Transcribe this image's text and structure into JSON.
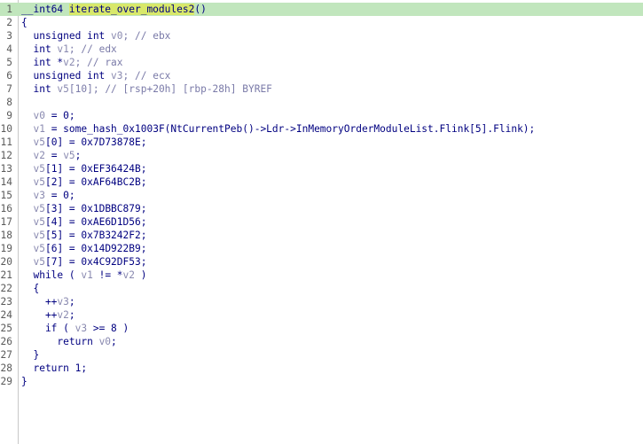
{
  "editor": {
    "lines": [
      {
        "n": "1",
        "parts": [
          {
            "t": "__int64 ",
            "c": "kw"
          },
          {
            "t": "iterate_over_modules2",
            "c": "fn-hl"
          },
          {
            "t": "()",
            "c": "plain"
          }
        ],
        "current": true
      },
      {
        "n": "2",
        "parts": [
          {
            "t": "{",
            "c": "plain"
          }
        ]
      },
      {
        "n": "3",
        "parts": [
          {
            "t": "  unsigned int ",
            "c": "kw"
          },
          {
            "t": "v0",
            "c": "var"
          },
          {
            "t": "; // ebx",
            "c": "cmt"
          }
        ]
      },
      {
        "n": "4",
        "parts": [
          {
            "t": "  int ",
            "c": "kw"
          },
          {
            "t": "v1",
            "c": "var"
          },
          {
            "t": "; // edx",
            "c": "cmt"
          }
        ]
      },
      {
        "n": "5",
        "parts": [
          {
            "t": "  int *",
            "c": "kw"
          },
          {
            "t": "v2",
            "c": "var"
          },
          {
            "t": "; // rax",
            "c": "cmt"
          }
        ]
      },
      {
        "n": "6",
        "parts": [
          {
            "t": "  unsigned int ",
            "c": "kw"
          },
          {
            "t": "v3",
            "c": "var"
          },
          {
            "t": "; // ecx",
            "c": "cmt"
          }
        ]
      },
      {
        "n": "7",
        "parts": [
          {
            "t": "  int ",
            "c": "kw"
          },
          {
            "t": "v5",
            "c": "var"
          },
          {
            "t": "[10]; // [rsp+20h] [rbp-28h] BYREF",
            "c": "cmt"
          }
        ]
      },
      {
        "n": "8",
        "parts": []
      },
      {
        "n": "9",
        "parts": [
          {
            "t": "  ",
            "c": "plain"
          },
          {
            "t": "v0",
            "c": "var"
          },
          {
            "t": " = 0;",
            "c": "plain"
          }
        ]
      },
      {
        "n": "10",
        "parts": [
          {
            "t": "  ",
            "c": "plain"
          },
          {
            "t": "v1",
            "c": "var"
          },
          {
            "t": " = some_hash_0x1003F(NtCurrentPeb()->Ldr->InMemoryOrderModuleList.Flink[5].Flink);",
            "c": "plain"
          }
        ]
      },
      {
        "n": "11",
        "parts": [
          {
            "t": "  ",
            "c": "plain"
          },
          {
            "t": "v5",
            "c": "var"
          },
          {
            "t": "[0] = 0x7D73878E;",
            "c": "plain"
          }
        ]
      },
      {
        "n": "12",
        "parts": [
          {
            "t": "  ",
            "c": "plain"
          },
          {
            "t": "v2",
            "c": "var"
          },
          {
            "t": " = ",
            "c": "plain"
          },
          {
            "t": "v5",
            "c": "var"
          },
          {
            "t": ";",
            "c": "plain"
          }
        ]
      },
      {
        "n": "13",
        "parts": [
          {
            "t": "  ",
            "c": "plain"
          },
          {
            "t": "v5",
            "c": "var"
          },
          {
            "t": "[1] = 0xEF36424B;",
            "c": "plain"
          }
        ]
      },
      {
        "n": "14",
        "parts": [
          {
            "t": "  ",
            "c": "plain"
          },
          {
            "t": "v5",
            "c": "var"
          },
          {
            "t": "[2] = 0xAF64BC2B;",
            "c": "plain"
          }
        ]
      },
      {
        "n": "15",
        "parts": [
          {
            "t": "  ",
            "c": "plain"
          },
          {
            "t": "v3",
            "c": "var"
          },
          {
            "t": " = 0;",
            "c": "plain"
          }
        ]
      },
      {
        "n": "16",
        "parts": [
          {
            "t": "  ",
            "c": "plain"
          },
          {
            "t": "v5",
            "c": "var"
          },
          {
            "t": "[3] = 0x1DBBC879;",
            "c": "plain"
          }
        ]
      },
      {
        "n": "17",
        "parts": [
          {
            "t": "  ",
            "c": "plain"
          },
          {
            "t": "v5",
            "c": "var"
          },
          {
            "t": "[4] = 0xAE6D1D56;",
            "c": "plain"
          }
        ]
      },
      {
        "n": "18",
        "parts": [
          {
            "t": "  ",
            "c": "plain"
          },
          {
            "t": "v5",
            "c": "var"
          },
          {
            "t": "[5] = 0x7B3242F2;",
            "c": "plain"
          }
        ]
      },
      {
        "n": "19",
        "parts": [
          {
            "t": "  ",
            "c": "plain"
          },
          {
            "t": "v5",
            "c": "var"
          },
          {
            "t": "[6] = 0x14D922B9;",
            "c": "plain"
          }
        ]
      },
      {
        "n": "20",
        "parts": [
          {
            "t": "  ",
            "c": "plain"
          },
          {
            "t": "v5",
            "c": "var"
          },
          {
            "t": "[7] = 0x4C92DF53;",
            "c": "plain"
          }
        ]
      },
      {
        "n": "21",
        "parts": [
          {
            "t": "  while ( ",
            "c": "kw"
          },
          {
            "t": "v1",
            "c": "var"
          },
          {
            "t": " != *",
            "c": "plain"
          },
          {
            "t": "v2",
            "c": "var"
          },
          {
            "t": " )",
            "c": "plain"
          }
        ]
      },
      {
        "n": "22",
        "parts": [
          {
            "t": "  {",
            "c": "plain"
          }
        ]
      },
      {
        "n": "23",
        "parts": [
          {
            "t": "    ++",
            "c": "plain"
          },
          {
            "t": "v3",
            "c": "var"
          },
          {
            "t": ";",
            "c": "plain"
          }
        ]
      },
      {
        "n": "24",
        "parts": [
          {
            "t": "    ++",
            "c": "plain"
          },
          {
            "t": "v2",
            "c": "var"
          },
          {
            "t": ";",
            "c": "plain"
          }
        ]
      },
      {
        "n": "25",
        "parts": [
          {
            "t": "    if ( ",
            "c": "kw"
          },
          {
            "t": "v3",
            "c": "var"
          },
          {
            "t": " >= 8 )",
            "c": "plain"
          }
        ]
      },
      {
        "n": "26",
        "parts": [
          {
            "t": "      return ",
            "c": "kw"
          },
          {
            "t": "v0",
            "c": "var"
          },
          {
            "t": ";",
            "c": "plain"
          }
        ]
      },
      {
        "n": "27",
        "parts": [
          {
            "t": "  }",
            "c": "plain"
          }
        ]
      },
      {
        "n": "28",
        "parts": [
          {
            "t": "  return 1;",
            "c": "kw"
          }
        ]
      },
      {
        "n": "29",
        "parts": [
          {
            "t": "}",
            "c": "plain"
          }
        ]
      }
    ]
  }
}
